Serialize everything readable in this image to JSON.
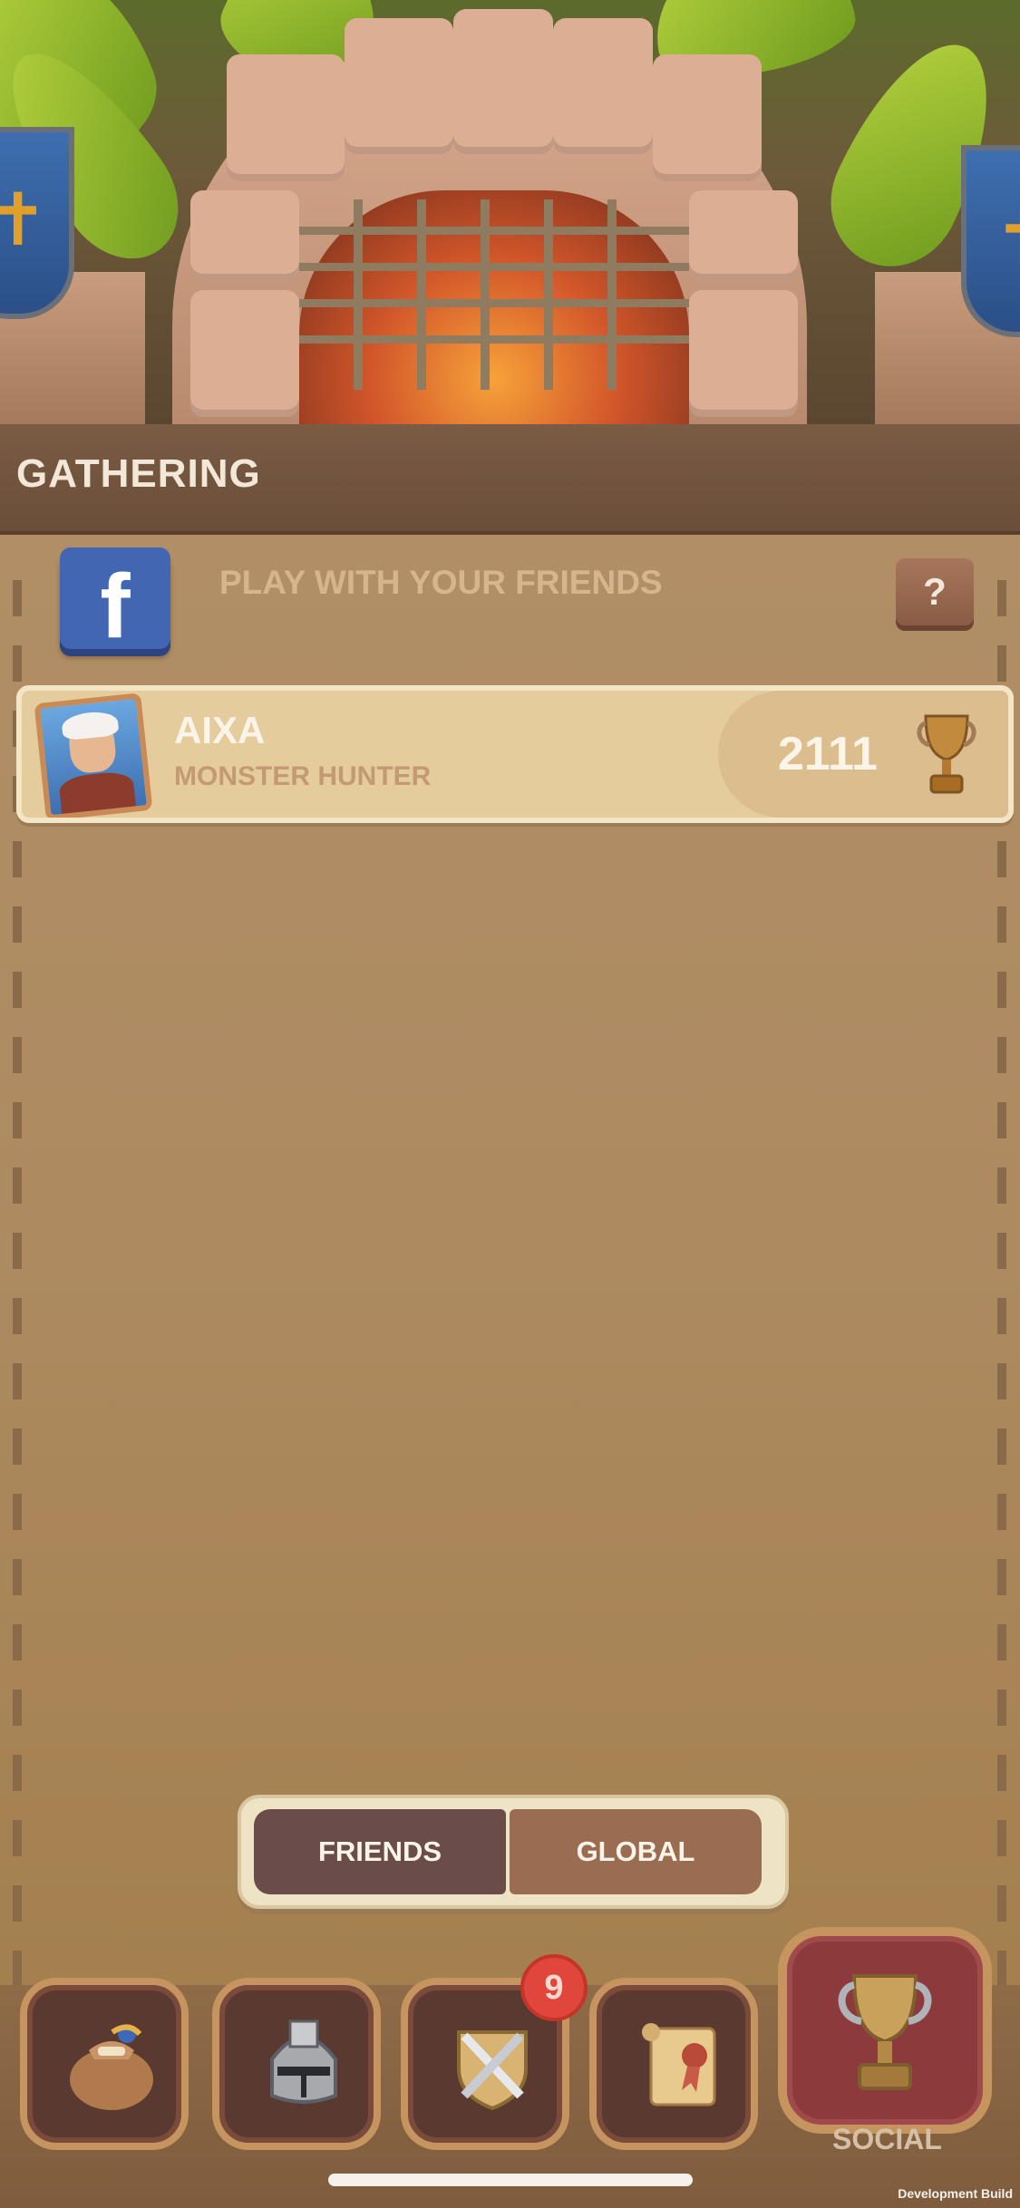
{
  "header": {
    "title": "GATHERING"
  },
  "facebook": {
    "icon_letter": "f",
    "prompt": "PLAY WITH YOUR FRIENDS",
    "help_label": "?"
  },
  "leaderboard": [
    {
      "name": "AIXA",
      "title": "MONSTER HUNTER",
      "score": "2111"
    }
  ],
  "toggle": {
    "friends_label": "FRIENDS",
    "global_label": "GLOBAL",
    "selected": "FRIENDS"
  },
  "bottom_nav": {
    "items": [
      {
        "icon": "loot-bag-icon"
      },
      {
        "icon": "knight-helmet-icon"
      },
      {
        "icon": "crossed-swords-shield-icon",
        "badge": "9"
      },
      {
        "icon": "scroll-icon"
      },
      {
        "icon": "trophy-icon",
        "label": "SOCIAL",
        "active": true
      }
    ]
  },
  "footer": {
    "build_label": "Development Build"
  },
  "colors": {
    "accent_active": "#8d3a3d",
    "facebook": "#4266b2",
    "badge": "#e0463c"
  }
}
